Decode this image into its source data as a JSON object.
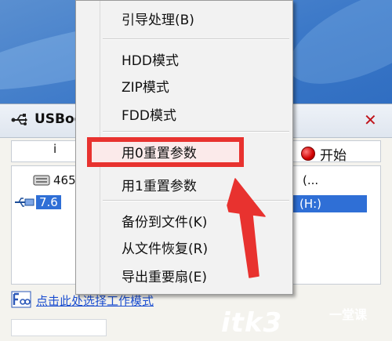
{
  "app": {
    "title_partial": "USBoo",
    "left_button_partial": "i",
    "start_label": "开始",
    "devices": [
      {
        "label": "465",
        "tail": "(..."
      },
      {
        "label": "7.6",
        "tail": "(H:)"
      }
    ],
    "hint_text": "点击此处选择工作模式"
  },
  "menu": {
    "items": [
      "引导处理(B)",
      "HDD模式",
      "ZIP模式",
      "FDD模式",
      "用0重置参数",
      "用1重置参数",
      "备份到文件(K)",
      "从文件恢复(R)",
      "导出重要扇(E)"
    ],
    "highlighted_item": "用0重置参数"
  },
  "annotation_color": "#e8322f",
  "watermark": {
    "main": "itk3",
    "sub_line1": "一堂课",
    "sub_line2": ""
  }
}
